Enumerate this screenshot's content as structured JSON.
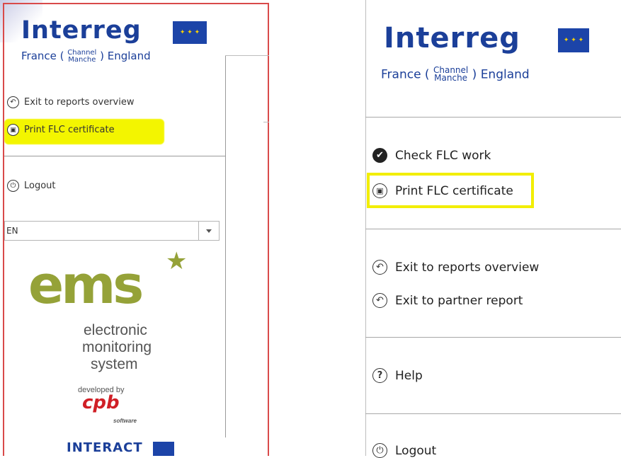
{
  "left_panel": {
    "logo": {
      "word": "Interreg",
      "sub_pre": "France (",
      "sub_top": "Channel",
      "sub_bottom": "Manche",
      "sub_post": ") England"
    },
    "menu": [
      {
        "label": "Exit to reports overview",
        "icon": "undo-arrow-icon"
      },
      {
        "label": "Print FLC certificate",
        "icon": "printer-icon",
        "highlighted": true
      }
    ],
    "logout_label": "Logout",
    "language": {
      "selected": "EN"
    },
    "ems": {
      "mark": "ems",
      "line1": "electronic",
      "line2": "monitoring",
      "line3": "system"
    },
    "developed_by": "developed by",
    "cpb": "cpb",
    "cpb_soft": "software",
    "interact": "INTERACT"
  },
  "right_panel": {
    "logo": {
      "word": "Interreg",
      "sub_pre": "France (",
      "sub_top": "Channel",
      "sub_bottom": "Manche",
      "sub_post": ") England"
    },
    "group1": [
      {
        "label": "Check FLC work",
        "icon": "check-circle-icon"
      },
      {
        "label": "Print FLC certificate",
        "icon": "printer-icon",
        "highlighted": true
      }
    ],
    "group2": [
      {
        "label": "Exit to reports overview",
        "icon": "undo-arrow-icon"
      },
      {
        "label": "Exit to partner report",
        "icon": "undo-arrow-icon"
      }
    ],
    "help_label": "Help",
    "logout_label": "Logout"
  },
  "colors": {
    "brand_blue": "#1b3f99",
    "highlight_yellow": "#f2ee00",
    "ems_green": "#95a238",
    "cpb_red": "#d01f26"
  }
}
